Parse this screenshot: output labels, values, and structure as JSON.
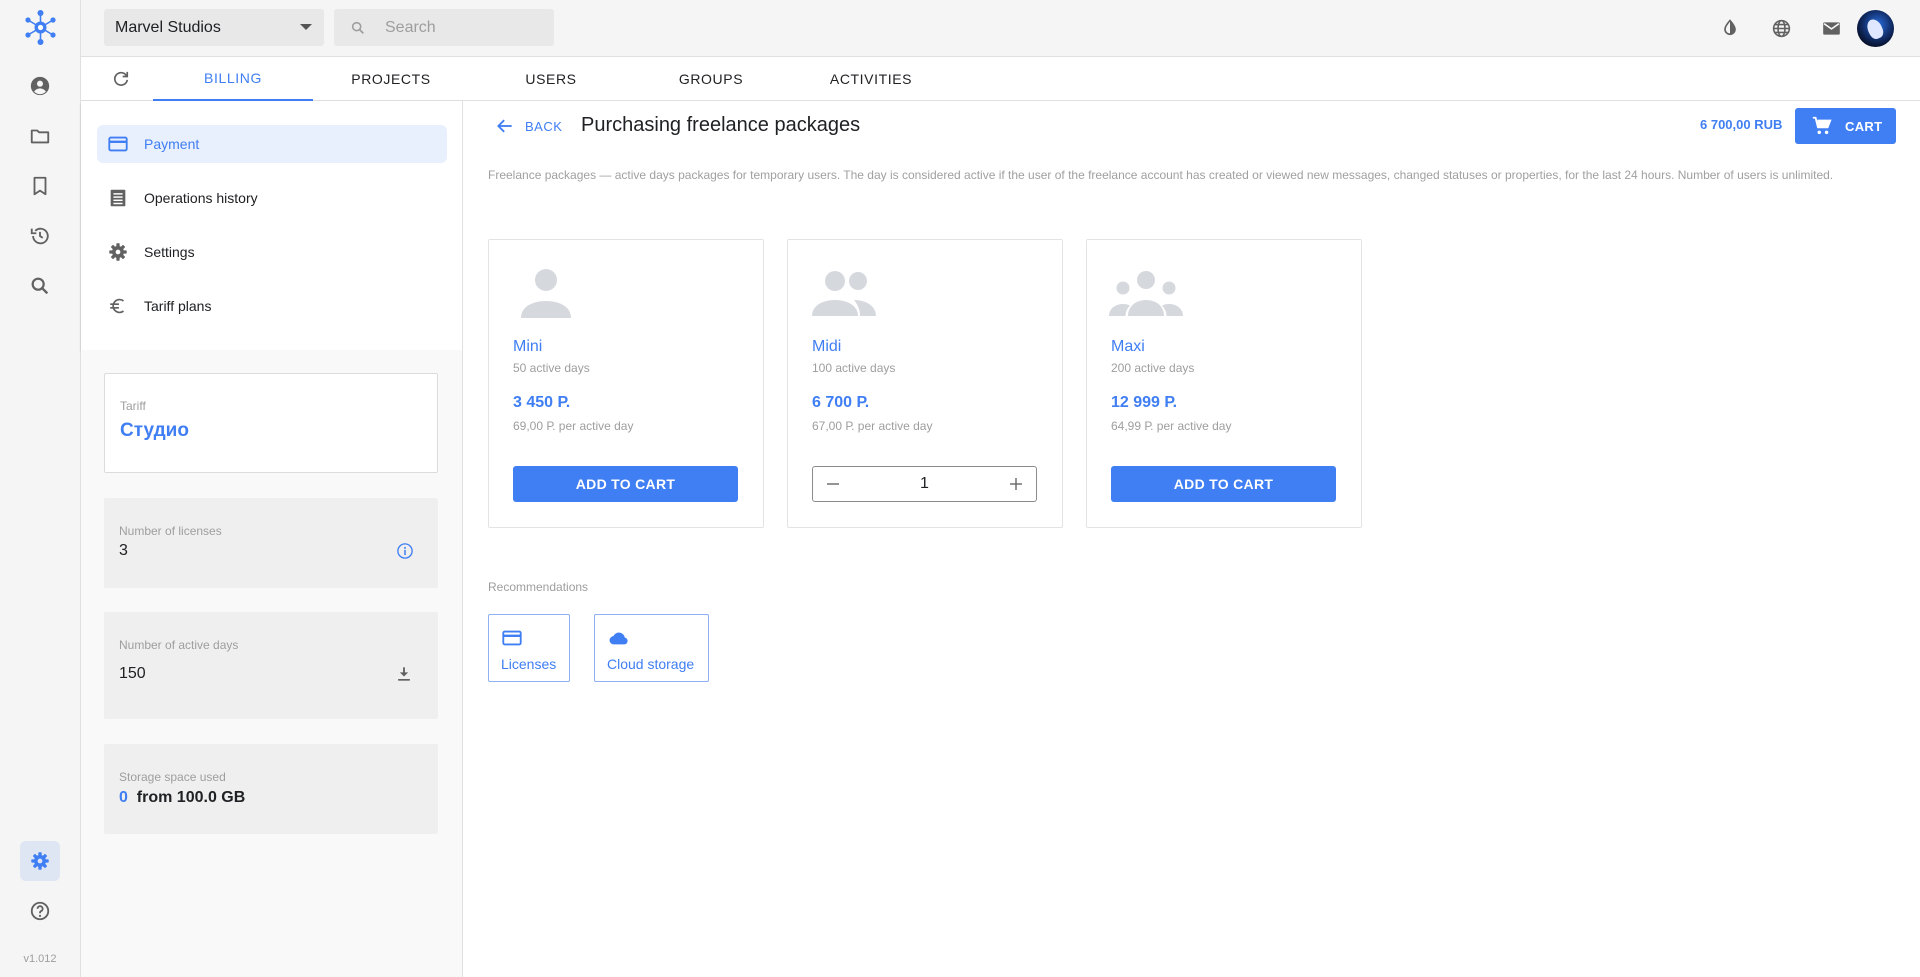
{
  "app": {
    "company": "Marvel Studios",
    "search_placeholder": "Search",
    "version": "v1.012"
  },
  "rail": {
    "items": [
      "profile-icon",
      "folder-icon",
      "bookmark-icon",
      "history-icon",
      "search-icon"
    ],
    "bottom": [
      "settings-icon",
      "help-icon"
    ]
  },
  "topbar_icons": [
    "contrast-icon",
    "globe-icon",
    "mail-icon",
    "avatar"
  ],
  "tabs": [
    {
      "label": "BILLING",
      "active": true
    },
    {
      "label": "PROJECTS",
      "active": false
    },
    {
      "label": "USERS",
      "active": false
    },
    {
      "label": "GROUPS",
      "active": false
    },
    {
      "label": "ACTIVITIES",
      "active": false
    }
  ],
  "sidenav": [
    {
      "label": "Payment",
      "icon": "credit-card-icon",
      "active": true
    },
    {
      "label": "Operations history",
      "icon": "receipt-icon",
      "active": false
    },
    {
      "label": "Settings",
      "icon": "gear-icon",
      "active": false
    },
    {
      "label": "Tariff plans",
      "icon": "euro-icon",
      "active": false
    }
  ],
  "tariff": {
    "label": "Tariff",
    "value": "Студио"
  },
  "licenses": {
    "label": "Number of licenses",
    "value": "3"
  },
  "active_days": {
    "label": "Number of active days",
    "value": "150"
  },
  "storage": {
    "label": "Storage space used",
    "used": "0",
    "total": "from 100.0 GB"
  },
  "page": {
    "back": "BACK",
    "title": "Purchasing freelance packages",
    "total": "6 700,00 RUB",
    "cart": "CART",
    "description": "Freelance packages — active days packages for temporary users. The day is considered active if the user of the freelance account has created or viewed new messages, changed statuses or properties, for the last 24 hours. Number of users is unlimited."
  },
  "packages": [
    {
      "name": "Mini",
      "days": "50 active days",
      "price": "3 450 Р.",
      "per_day": "69,00 Р. per active day",
      "button": "ADD TO CART",
      "icon": "person-icon"
    },
    {
      "name": "Midi",
      "days": "100 active days",
      "price": "6 700 Р.",
      "per_day": "67,00 Р. per active day",
      "quantity": "1",
      "icon": "people-icon"
    },
    {
      "name": "Maxi",
      "days": "200 active days",
      "price": "12 999 Р.",
      "per_day": "64,99 Р. per active day",
      "button": "ADD TO CART",
      "icon": "group-icon"
    }
  ],
  "recommendations": {
    "label": "Recommendations",
    "items": [
      {
        "label": "Licenses",
        "icon": "credit-card-icon"
      },
      {
        "label": "Cloud storage",
        "icon": "cloud-icon"
      }
    ]
  },
  "colors": {
    "accent": "#3f7ef3",
    "muted": "#9e9e9e",
    "rail": "#f5f5f5"
  }
}
